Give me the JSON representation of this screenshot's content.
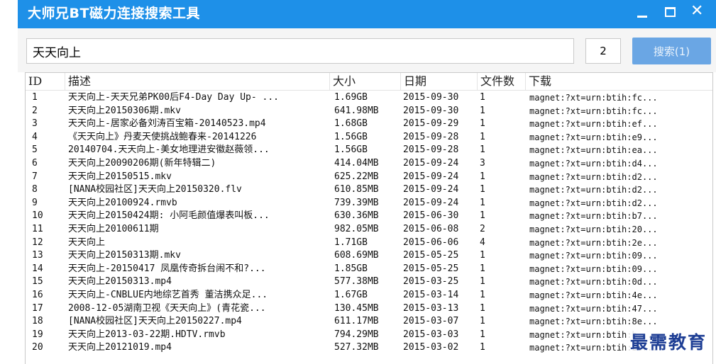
{
  "window": {
    "title": "大师兄BT磁力连接搜索工具"
  },
  "search": {
    "query": "天天向上",
    "page": "2",
    "button_label": "搜索(1)"
  },
  "table": {
    "headers": [
      "ID",
      "描述",
      "大小",
      "日期",
      "文件数",
      "下载"
    ],
    "rows": [
      [
        "1",
        "天天向上-天天兄弟PK00后F4-Day Day Up- ...",
        "1.69GB",
        "2015-09-30",
        "1",
        "magnet:?xt=urn:btih:fc..."
      ],
      [
        "2",
        "天天向上20150306期.mkv",
        "641.98MB",
        "2015-09-30",
        "1",
        "magnet:?xt=urn:btih:fc..."
      ],
      [
        "3",
        "天天向上-居家必备刘涛百宝箱-20140523.mp4",
        "1.68GB",
        "2015-09-29",
        "1",
        "magnet:?xt=urn:btih:ef..."
      ],
      [
        "4",
        "《天天向上》丹麦天使挑战鲍春来-20141226",
        "1.56GB",
        "2015-09-28",
        "1",
        "magnet:?xt=urn:btih:e9..."
      ],
      [
        "5",
        "20140704.天天向上-美女地理进安徽赵薇领...",
        "1.56GB",
        "2015-09-28",
        "1",
        "magnet:?xt=urn:btih:ea..."
      ],
      [
        "6",
        "天天向上20090206期(新年特辑二)",
        "414.04MB",
        "2015-09-24",
        "3",
        "magnet:?xt=urn:btih:d4..."
      ],
      [
        "7",
        "天天向上20150515.mkv",
        "625.22MB",
        "2015-09-24",
        "1",
        "magnet:?xt=urn:btih:d2..."
      ],
      [
        "8",
        "[NANA校园社区]天天向上20150320.flv",
        "610.85MB",
        "2015-09-24",
        "1",
        "magnet:?xt=urn:btih:d2..."
      ],
      [
        "9",
        "天天向上20100924.rmvb",
        "739.39MB",
        "2015-09-24",
        "1",
        "magnet:?xt=urn:btih:d2..."
      ],
      [
        "10",
        "天天向上20150424期: 小阿毛颜值爆表叫板...",
        "630.36MB",
        "2015-06-30",
        "1",
        "magnet:?xt=urn:btih:b7..."
      ],
      [
        "11",
        "天天向上20100611期",
        "982.05MB",
        "2015-06-08",
        "2",
        "magnet:?xt=urn:btih:20..."
      ],
      [
        "12",
        "天天向上",
        "1.71GB",
        "2015-06-06",
        "4",
        "magnet:?xt=urn:btih:2e..."
      ],
      [
        "13",
        "天天向上20150313期.mkv",
        "608.69MB",
        "2015-05-25",
        "1",
        "magnet:?xt=urn:btih:09..."
      ],
      [
        "14",
        "天天向上-20150417 凤凰传奇拆台闹不和?...",
        "1.85GB",
        "2015-05-25",
        "1",
        "magnet:?xt=urn:btih:09..."
      ],
      [
        "15",
        "天天向上20150313.mp4",
        "577.38MB",
        "2015-03-25",
        "1",
        "magnet:?xt=urn:btih:0d..."
      ],
      [
        "16",
        "天天向上-CNBLUE内地综艺首秀 董洁携众足...",
        "1.67GB",
        "2015-03-14",
        "1",
        "magnet:?xt=urn:btih:4e..."
      ],
      [
        "17",
        "2008-12-05湖南卫视《天天向上》(青花瓷...",
        "130.45MB",
        "2015-03-13",
        "1",
        "magnet:?xt=urn:btih:47..."
      ],
      [
        "18",
        "[NANA校园社区]天天向上20150227.mp4",
        "611.17MB",
        "2015-03-07",
        "1",
        "magnet:?xt=urn:btih:8e..."
      ],
      [
        "19",
        "天天向上2013-03-22期.HDTV.rmvb",
        "794.29MB",
        "2015-03-03",
        "1",
        "magnet:?xt=urn:btih:b..."
      ],
      [
        "20",
        "天天向上20121019.mp4",
        "527.32MB",
        "2015-03-02",
        "1",
        "magnet:?xt=urn:btih:bc..."
      ]
    ]
  },
  "watermark": "最需教育"
}
